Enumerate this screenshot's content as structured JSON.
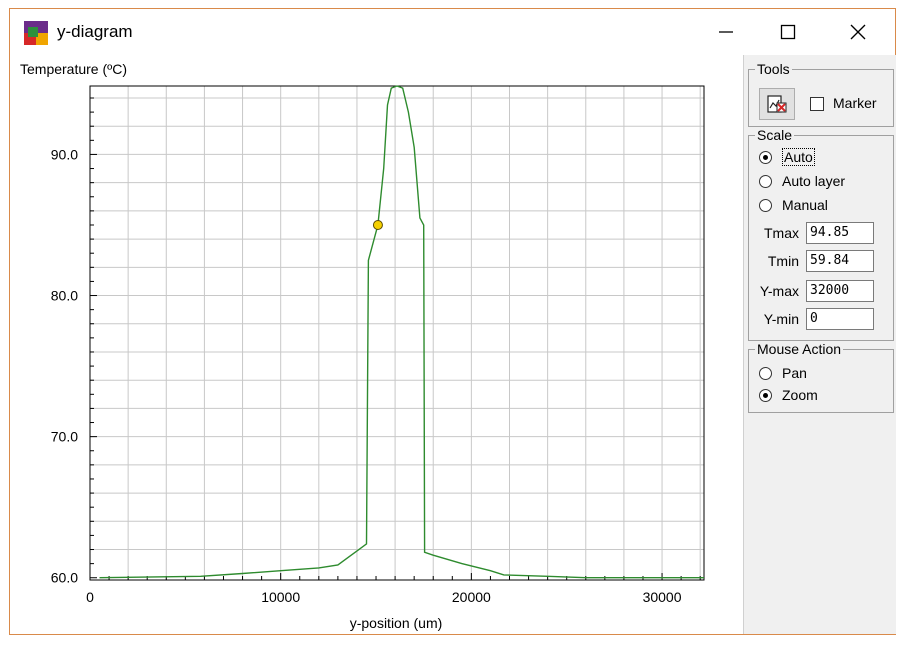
{
  "window": {
    "title": "y-diagram"
  },
  "titlebar_controls": {
    "minimize_icon": "minimize-icon",
    "maximize_icon": "maximize-icon",
    "close_icon": "close-icon"
  },
  "chart_data": {
    "type": "line",
    "title": "",
    "ylabel": "Temperature (ºC)",
    "xlabel": "y-position (um)",
    "xlim": [
      0,
      32200
    ],
    "ylim": [
      59.84,
      94.85
    ],
    "x_ticks": [
      0,
      10000,
      20000,
      30000
    ],
    "x_tick_labels": [
      "0",
      "10000",
      "20000",
      "30000"
    ],
    "y_ticks": [
      60,
      70,
      80,
      90
    ],
    "y_tick_labels": [
      "60.0",
      "70.0",
      "80.0",
      "90.0"
    ],
    "grid": true,
    "line_color": "#2e8b2e",
    "marker_color": "#f5d000",
    "series": [
      {
        "x": [
          500,
          5800,
          8000,
          10000,
          12000,
          13000,
          13600,
          14000,
          14500,
          14600,
          14800,
          15100,
          15400,
          15600,
          15800,
          16100,
          16400,
          16700,
          17000,
          17300,
          17500,
          17550,
          18000,
          19500,
          21000,
          21700,
          24000,
          26000,
          27000,
          32200
        ],
        "y": [
          60.0,
          60.1,
          60.3,
          60.5,
          60.7,
          60.9,
          61.5,
          61.9,
          62.4,
          82.5,
          83.5,
          85.0,
          89.0,
          93.5,
          94.7,
          94.85,
          94.7,
          93.0,
          90.5,
          85.5,
          85.0,
          61.8,
          61.6,
          61.0,
          60.5,
          60.2,
          60.1,
          60.0,
          60.0,
          60.0
        ]
      }
    ],
    "marker": {
      "x": 15100,
      "y": 85.0
    }
  },
  "panel": {
    "tools": {
      "label": "Tools",
      "tool_icon": "export-plot-icon",
      "marker_label": "Marker",
      "marker_checked": false
    },
    "scale": {
      "label": "Scale",
      "options": [
        {
          "label": "Auto",
          "selected": true
        },
        {
          "label": "Auto layer",
          "selected": false
        },
        {
          "label": "Manual",
          "selected": false
        }
      ],
      "fields": [
        {
          "label": "Tmax",
          "value": "94.85"
        },
        {
          "label": "Tmin",
          "value": "59.84"
        },
        {
          "label": "Y-max",
          "value": "32000"
        },
        {
          "label": "Y-min",
          "value": "0"
        }
      ]
    },
    "mouse_action": {
      "label": "Mouse Action",
      "options": [
        {
          "label": "Pan",
          "selected": false
        },
        {
          "label": "Zoom",
          "selected": true
        }
      ]
    }
  }
}
